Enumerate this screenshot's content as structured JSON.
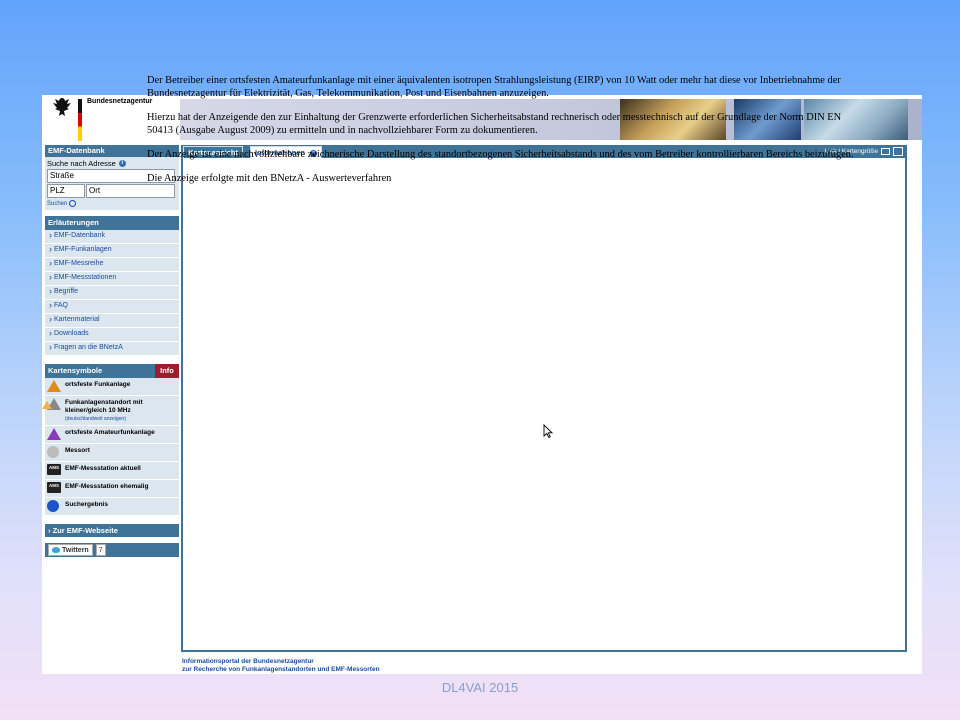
{
  "header": {
    "org_name": "Bundesnetzagentur"
  },
  "sidebar": {
    "database_title": "EMF-Datenbank",
    "search_label": "Suche nach Adresse",
    "street_value": "Straße",
    "plz_value": "PLZ",
    "city_value": "Ort",
    "search_button": "Suchen",
    "explanations_title": "Erläuterungen",
    "nav_items": [
      {
        "label": "EMF-Datenbank"
      },
      {
        "label": "EMF-Funkanlagen"
      },
      {
        "label": "EMF-Messreihe"
      },
      {
        "label": "EMF-Messstationen"
      },
      {
        "label": "Begriffe"
      },
      {
        "label": "FAQ"
      },
      {
        "label": "Kartenmaterial"
      },
      {
        "label": "Downloads"
      },
      {
        "label": "Fragen an die BNetzA"
      }
    ],
    "symbols_title": "Kartensymbole",
    "info_button": "Info",
    "symbols": [
      {
        "label": "ortsfeste Funkanlage",
        "icon": "orange-triangle-icon"
      },
      {
        "label": "Funkanlagenstandort mit kleiner/gleich 10 MHz",
        "sublabel": "(deutschlandweit anzeigen)",
        "icon": "outlined-triangle-icon"
      },
      {
        "label": "ortsfeste Amateurfunkanlage",
        "icon": "purple-triangle-icon"
      },
      {
        "label": "Messort",
        "icon": "grey-circle-icon"
      },
      {
        "label": "EMF-Messstation aktuell",
        "icon": "ams-current-icon",
        "badge": "AMS"
      },
      {
        "label": "EMF-Messstation ehemalig",
        "icon": "ams-former-icon",
        "badge": "AMS"
      },
      {
        "label": "Suchergebnis",
        "icon": "blue-circle-icon"
      }
    ],
    "emf_link": "Zur EMF-Webseite",
    "twitter_label": "Twittern",
    "twitter_count": "7"
  },
  "tabs": {
    "tab1": "Kartenansicht",
    "tab2": "Informationen",
    "right_links": "Link | Kartengröße"
  },
  "content": {
    "paragraphs": [
      "Der Betreiber einer ortsfesten Amateurfunkanlage mit einer äquivalenten isotropen Strahlungsleistung (EIRP) von 10 Watt oder mehr hat diese vor Inbetriebnahme der Bundesnetzagentur für Elektrizität, Gas, Telekommunikation, Post und Eisenbahnen anzuzeigen.",
      "Hierzu hat der Anzeigende den zur Einhaltung der Grenzwerte erforderlichen Sicherheitsabstand rechnerisch oder messtechnisch auf der Grundlage der Norm DIN EN 50413 (Ausgabe August 2009) zu ermitteln und in nachvollziehbarer Form zu dokumentieren.",
      "Der Anzeige ist eine nachvollziehbare zeichnerische Darstellung des standortbezogenen Sicherheitsabstands und des vom Betreiber kontrollierbaren Bereichs beizufügen.",
      "Die Anzeige erfolgte mit den BNetzA - Auswerteverfahren"
    ]
  },
  "footer": {
    "line1": "Informationsportal der Bundesnetzagentur",
    "line2": "zur Recherche von Funkanlagenstandorten und EMF-Messorten"
  },
  "caption": "DL4VAI 2015",
  "colors": {
    "accent": "#3f7397",
    "link": "#1a4b9a",
    "info_red": "#9a1e2e"
  }
}
